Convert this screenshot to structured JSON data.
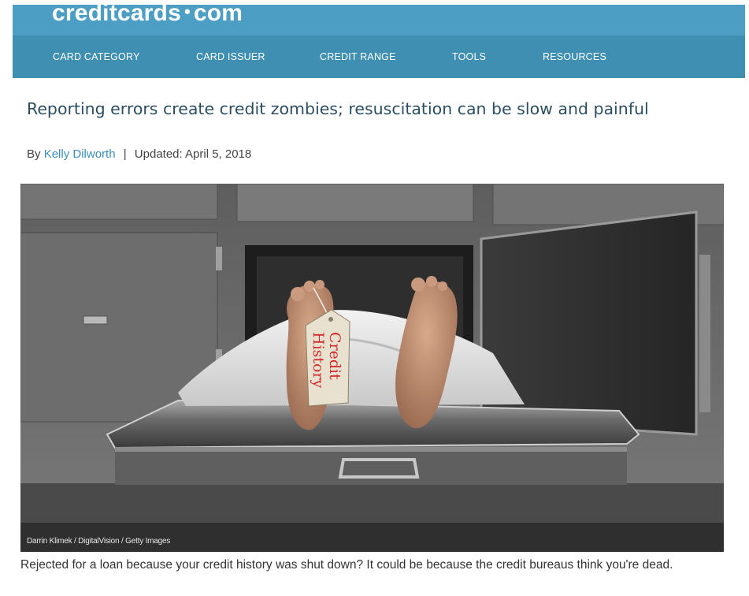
{
  "header": {
    "logo_main": "creditcards",
    "logo_dot": "•",
    "logo_tld": "com",
    "nav": [
      "CARD CATEGORY",
      "CARD ISSUER",
      "CREDIT RANGE",
      "TOOLS",
      "RESOURCES"
    ]
  },
  "article": {
    "title": "Reporting errors create credit zombies; resuscitation can be slow and painful",
    "byline_prefix": "By",
    "author": "Kelly Dilworth",
    "separator": "|",
    "updated": "Updated: April 5, 2018",
    "image_credit": "Darrin Klimek / DigitalVision / Getty Images",
    "toe_tag_text": [
      "Credit",
      "History"
    ],
    "caption": "Rejected for a loan because your credit history was shut down? It could be because the credit bureaus think you're dead."
  },
  "colors": {
    "header_nav": "#3f8fb3",
    "header_top": "#4d9ec4",
    "title_text": "#2c4e60",
    "link": "#3b8ebc"
  }
}
